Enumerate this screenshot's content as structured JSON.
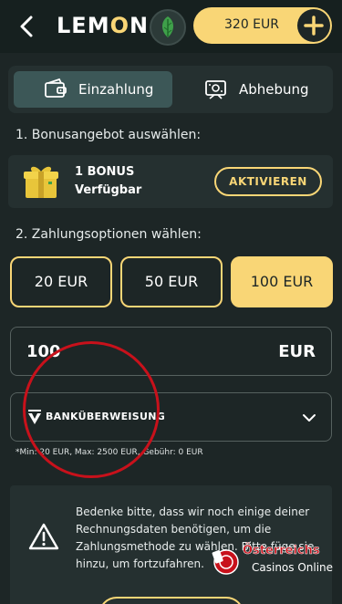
{
  "header": {
    "logo": "LEMON",
    "balance": "320 EUR"
  },
  "tabs": [
    {
      "label": "Einzahlung",
      "active": true
    },
    {
      "label": "Abhebung",
      "active": false
    }
  ],
  "bonus": {
    "title": "1. Bonusangebot auswählen:",
    "count": "1 BONUS",
    "status": "Verfügbar",
    "button": "AKTIVIEREN"
  },
  "payment": {
    "title": "2. Zahlungsoptionen wählen:",
    "amounts": [
      {
        "label": "20 EUR",
        "selected": false
      },
      {
        "label": "50 EUR",
        "selected": false
      },
      {
        "label": "100 EUR",
        "selected": true
      }
    ],
    "amount_value": "100",
    "currency": "EUR",
    "method": "BANKÜBERWEISUNG",
    "limits": "*Min: 20 EUR, Max: 2500 EUR, Gebühr: 0 EUR"
  },
  "notice": {
    "text": "Bedenke bitte, dass wir noch einige deiner Rechnungsdaten benötigen, um die Zahlungsmethode zu wählen. Bitte füge sie hinzu, um fortzufahren."
  },
  "watermark": {
    "title": "Österreichs",
    "subtitle": "Casinos Online"
  },
  "colors": {
    "background": "#1d2626",
    "accent": "#f9d676",
    "panel": "#253030",
    "active_tab": "#3c5757",
    "annotation": "#c8111b"
  }
}
